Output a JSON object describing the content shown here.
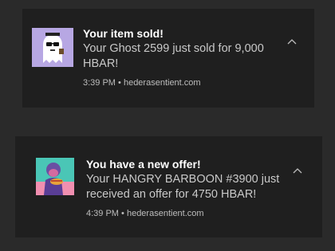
{
  "notifications": [
    {
      "title": "Your item sold!",
      "message": "Your Ghost 2599 just sold for 9,000 HBAR!",
      "time": "3:39 PM",
      "separator": "•",
      "source": "hederasentient.com",
      "thumbnail": "ghost-nft-thumbnail",
      "thumb_bg": "#b7a7e3"
    },
    {
      "title": "You have a new offer!",
      "message": "Your HANGRY BARBOON #3900 just received an offer for 4750 HBAR!",
      "time": "4:39 PM",
      "separator": "•",
      "source": "hederasentient.com",
      "thumbnail": "barboon-nft-thumbnail",
      "thumb_bg": "#4ac6b6"
    }
  ],
  "colors": {
    "background": "#2a2a2a",
    "toast_bg": "#1f1f1f",
    "title_text": "#ffffff",
    "body_text": "#c9c9c9",
    "meta_text": "#bdbdbd"
  }
}
